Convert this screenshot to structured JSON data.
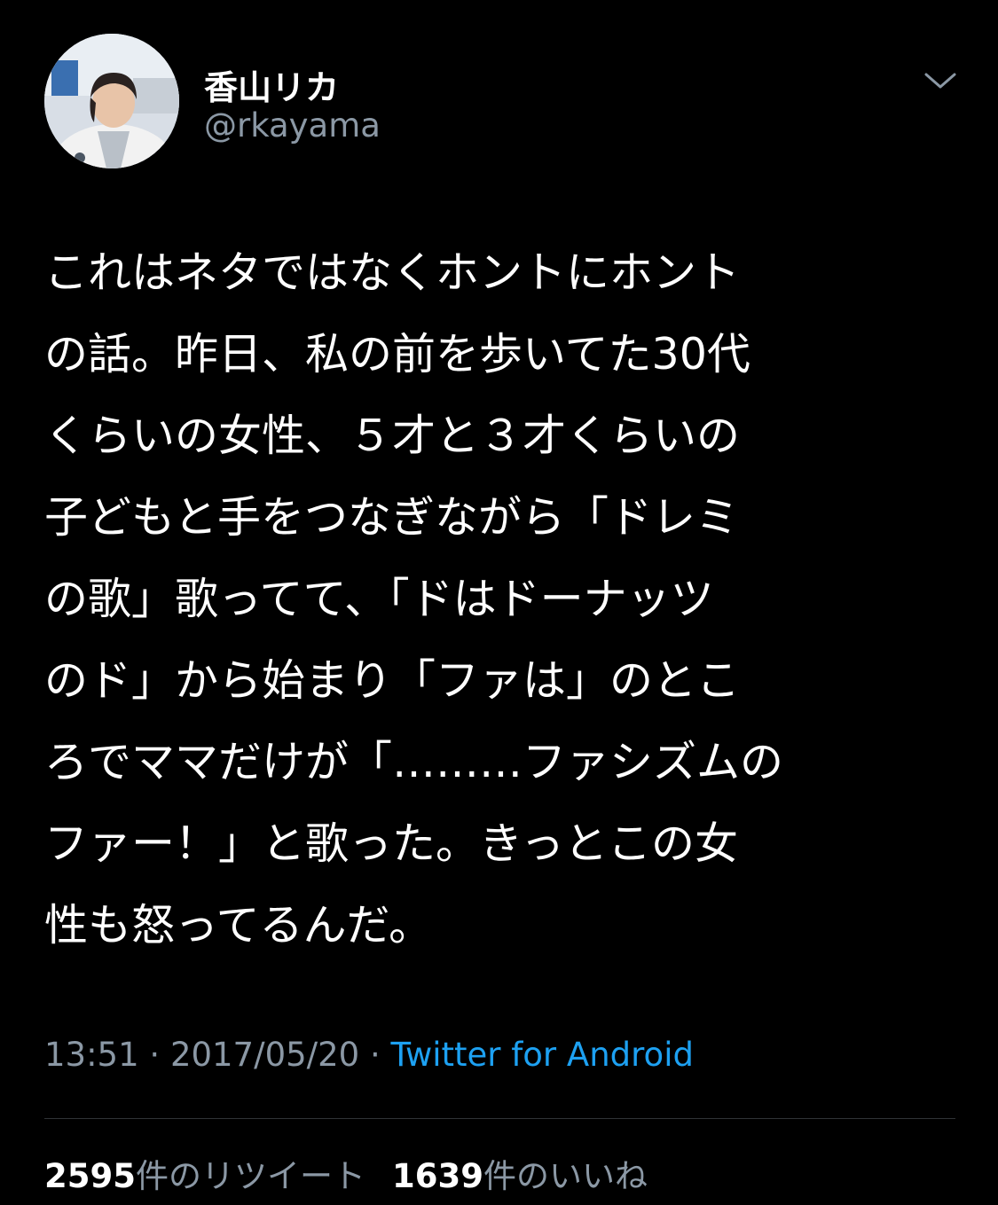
{
  "user": {
    "display_name": "香山リカ",
    "handle": "@rkayama"
  },
  "tweet": {
    "lines": [
      "これはネタではなくホントにホント",
      "の話。昨日、私の前を歩いてた30代",
      "くらいの女性、５才と３才くらいの",
      "子どもと手をつなぎながら「ドレミ",
      "の歌」歌ってて、「ドはドーナッツ",
      "のド」から始まり「ファは」のとこ",
      "ろでママだけが「………ファシズムの",
      "ファー！」と歌った。きっとこの女",
      "性も怒ってるんだ。"
    ]
  },
  "meta": {
    "time": "13:51",
    "date": "2017/05/20",
    "separator": " · ",
    "source": "Twitter for Android"
  },
  "stats": {
    "retweets_count": "2595",
    "retweets_label": "件のリツイート",
    "likes_count": "1639",
    "likes_label": "件のいいね"
  },
  "colors": {
    "background": "#000000",
    "text": "#ffffff",
    "secondary": "#8b98a5",
    "link": "#1da1f2",
    "divider": "#2f3336"
  },
  "icons": {
    "caret": "chevron-down-icon",
    "avatar": "profile-avatar"
  }
}
